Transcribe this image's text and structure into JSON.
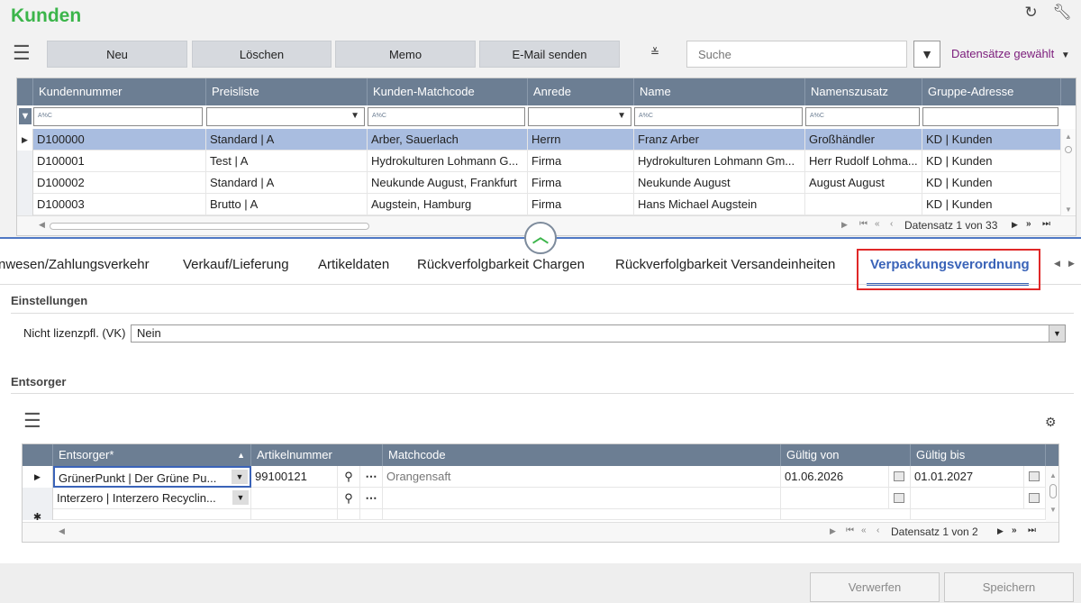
{
  "app": {
    "title": "Kunden"
  },
  "top_icons": [
    "refresh-icon",
    "wrench-icon"
  ],
  "toolbar": {
    "new_label": "Neu",
    "delete_label": "Löschen",
    "memo_label": "Memo",
    "email_label": "E-Mail senden",
    "search_placeholder": "Suche",
    "records_selected": "Datensätze gewählt"
  },
  "customers_grid": {
    "columns": [
      "Kundennummer",
      "Preisliste",
      "Kunden-Matchcode",
      "Anrede",
      "Name",
      "Namenszusatz",
      "Gruppe-Adresse"
    ],
    "filter_hint": "A%C",
    "rows": [
      [
        "D100000",
        "Standard | A",
        "Arber, Sauerlach",
        "Herrn",
        "Franz Arber",
        "Großhändler",
        "KD | Kunden"
      ],
      [
        "D100001",
        "Test | A",
        "Hydrokulturen Lohmann G...",
        "Firma",
        "Hydrokulturen Lohmann Gm...",
        "Herr Rudolf Lohma...",
        "KD | Kunden"
      ],
      [
        "D100002",
        "Standard | A",
        "Neukunde August, Frankfurt",
        "Firma",
        "Neukunde August",
        "August August",
        "KD | Kunden"
      ],
      [
        "D100003",
        "Brutto | A",
        "Augstein, Hamburg",
        "Firma",
        "Hans Michael Augstein",
        "",
        "KD | Kunden"
      ]
    ],
    "pager_text": "Datensatz 1 von 33"
  },
  "tabs": [
    "nwesen/Zahlungsverkehr",
    "Verkauf/Lieferung",
    "Artikeldaten",
    "Rückverfolgbarkeit Chargen",
    "Rückverfolgbarkeit Versandeinheiten",
    "Verpackungsverordnung"
  ],
  "active_tab": "Verpackungsverordnung",
  "settings": {
    "section_title": "Einstellungen",
    "field_label": "Nicht lizenzpfl. (VK)",
    "field_value": "Nein"
  },
  "disposer": {
    "section_title": "Entsorger",
    "columns": [
      "Entsorger*",
      "Artikelnummer",
      "Matchcode",
      "Gültig von",
      "Gültig bis"
    ],
    "rows": [
      [
        "GrünerPunkt | Der Grüne Pu...",
        "99100121",
        "Orangensaft",
        "01.06.2026",
        "01.01.2027"
      ],
      [
        "Interzero | Interzero Recyclin...",
        "",
        "",
        "",
        ""
      ]
    ],
    "pager_text": "Datensatz 1 von 2"
  },
  "footer": {
    "discard_label": "Verwerfen",
    "save_label": "Speichern"
  },
  "colors": {
    "accent_green": "#3bb54a",
    "header_slate": "#6c7e93",
    "selected_row": "#a9bde0",
    "active_tab": "#3a63b8",
    "highlight_red": "#e02828",
    "records_purple": "#7b1c7b"
  }
}
